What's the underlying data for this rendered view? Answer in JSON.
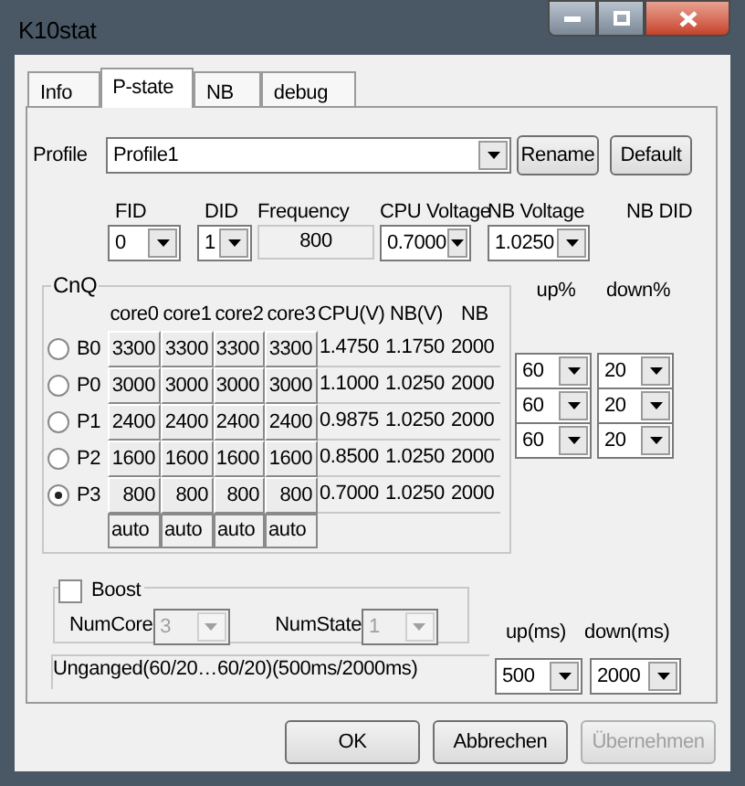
{
  "window": {
    "title": "K10stat"
  },
  "tabs": [
    {
      "label": "Info",
      "selected": false
    },
    {
      "label": "P-state",
      "selected": true
    },
    {
      "label": "NB",
      "selected": false
    },
    {
      "label": "debug",
      "selected": false
    }
  ],
  "profile": {
    "label": "Profile",
    "value": "Profile1",
    "buttons": [
      "Rename",
      "Default"
    ]
  },
  "pstate_fields": [
    {
      "label": "FID",
      "value": "0",
      "kind": "combo"
    },
    {
      "label": "DID",
      "value": "1",
      "kind": "combo"
    },
    {
      "label": "Frequency",
      "value": "800",
      "kind": "readout"
    },
    {
      "label": "CPU Voltage",
      "value": "0.7000",
      "kind": "combo"
    },
    {
      "label": "NB Voltage",
      "value": "1.0250",
      "kind": "combo"
    },
    {
      "label": "NB DID",
      "kind": "label"
    }
  ],
  "cnq": {
    "title": "CnQ",
    "columns": [
      "core0",
      "core1",
      "core2",
      "core3",
      "CPU(V)",
      "NB(V)",
      "NB"
    ],
    "threshold_columns": [
      "up%",
      "down%"
    ],
    "rows": [
      {
        "label": "B0",
        "selected": false,
        "cells": [
          "3300",
          "3300",
          "3300",
          "3300",
          "1.4750",
          "1.1750",
          "2000"
        ]
      },
      {
        "label": "P0",
        "selected": false,
        "cells": [
          "3000",
          "3000",
          "3000",
          "3000",
          "1.1000",
          "1.0250",
          "2000"
        ]
      },
      {
        "label": "P1",
        "selected": false,
        "cells": [
          "2400",
          "2400",
          "2400",
          "2400",
          "0.9875",
          "1.0250",
          "2000"
        ],
        "up": "60",
        "down": "20"
      },
      {
        "label": "P2",
        "selected": false,
        "cells": [
          "1600",
          "1600",
          "1600",
          "1600",
          "0.8500",
          "1.0250",
          "2000"
        ],
        "up": "60",
        "down": "20"
      },
      {
        "label": "P3",
        "selected": true,
        "cells": [
          "800",
          "800",
          "800",
          "800",
          "0.7000",
          "1.0250",
          "2000"
        ],
        "up": "60",
        "down": "20"
      }
    ],
    "auto_row": [
      "auto",
      "auto",
      "auto",
      "auto"
    ]
  },
  "boost": {
    "label": "Boost",
    "checked": false,
    "fields": [
      {
        "label": "NumCore",
        "value": "3",
        "disabled": true
      },
      {
        "label": "NumState",
        "value": "1",
        "disabled": true
      }
    ]
  },
  "timing": {
    "columns": [
      "up(ms)",
      "down(ms)"
    ],
    "values": [
      "500",
      "2000"
    ]
  },
  "status": "Unganged(60/20…60/20)(500ms/2000ms)",
  "buttons": [
    {
      "label": "OK",
      "disabled": false
    },
    {
      "label": "Abbrechen",
      "disabled": false
    },
    {
      "label": "Übernehmen",
      "disabled": true
    }
  ]
}
